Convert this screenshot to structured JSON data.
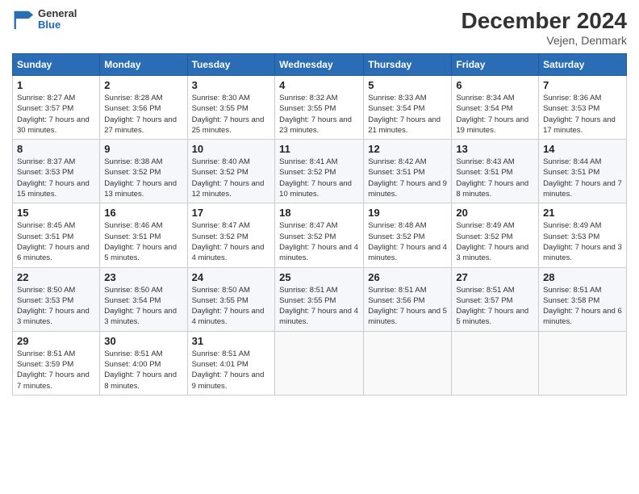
{
  "logo": {
    "general": "General",
    "blue": "Blue"
  },
  "title": "December 2024",
  "location": "Vejen, Denmark",
  "headers": [
    "Sunday",
    "Monday",
    "Tuesday",
    "Wednesday",
    "Thursday",
    "Friday",
    "Saturday"
  ],
  "weeks": [
    [
      {
        "day": "1",
        "sunrise": "Sunrise: 8:27 AM",
        "sunset": "Sunset: 3:57 PM",
        "daylight": "Daylight: 7 hours and 30 minutes."
      },
      {
        "day": "2",
        "sunrise": "Sunrise: 8:28 AM",
        "sunset": "Sunset: 3:56 PM",
        "daylight": "Daylight: 7 hours and 27 minutes."
      },
      {
        "day": "3",
        "sunrise": "Sunrise: 8:30 AM",
        "sunset": "Sunset: 3:55 PM",
        "daylight": "Daylight: 7 hours and 25 minutes."
      },
      {
        "day": "4",
        "sunrise": "Sunrise: 8:32 AM",
        "sunset": "Sunset: 3:55 PM",
        "daylight": "Daylight: 7 hours and 23 minutes."
      },
      {
        "day": "5",
        "sunrise": "Sunrise: 8:33 AM",
        "sunset": "Sunset: 3:54 PM",
        "daylight": "Daylight: 7 hours and 21 minutes."
      },
      {
        "day": "6",
        "sunrise": "Sunrise: 8:34 AM",
        "sunset": "Sunset: 3:54 PM",
        "daylight": "Daylight: 7 hours and 19 minutes."
      },
      {
        "day": "7",
        "sunrise": "Sunrise: 8:36 AM",
        "sunset": "Sunset: 3:53 PM",
        "daylight": "Daylight: 7 hours and 17 minutes."
      }
    ],
    [
      {
        "day": "8",
        "sunrise": "Sunrise: 8:37 AM",
        "sunset": "Sunset: 3:53 PM",
        "daylight": "Daylight: 7 hours and 15 minutes."
      },
      {
        "day": "9",
        "sunrise": "Sunrise: 8:38 AM",
        "sunset": "Sunset: 3:52 PM",
        "daylight": "Daylight: 7 hours and 13 minutes."
      },
      {
        "day": "10",
        "sunrise": "Sunrise: 8:40 AM",
        "sunset": "Sunset: 3:52 PM",
        "daylight": "Daylight: 7 hours and 12 minutes."
      },
      {
        "day": "11",
        "sunrise": "Sunrise: 8:41 AM",
        "sunset": "Sunset: 3:52 PM",
        "daylight": "Daylight: 7 hours and 10 minutes."
      },
      {
        "day": "12",
        "sunrise": "Sunrise: 8:42 AM",
        "sunset": "Sunset: 3:51 PM",
        "daylight": "Daylight: 7 hours and 9 minutes."
      },
      {
        "day": "13",
        "sunrise": "Sunrise: 8:43 AM",
        "sunset": "Sunset: 3:51 PM",
        "daylight": "Daylight: 7 hours and 8 minutes."
      },
      {
        "day": "14",
        "sunrise": "Sunrise: 8:44 AM",
        "sunset": "Sunset: 3:51 PM",
        "daylight": "Daylight: 7 hours and 7 minutes."
      }
    ],
    [
      {
        "day": "15",
        "sunrise": "Sunrise: 8:45 AM",
        "sunset": "Sunset: 3:51 PM",
        "daylight": "Daylight: 7 hours and 6 minutes."
      },
      {
        "day": "16",
        "sunrise": "Sunrise: 8:46 AM",
        "sunset": "Sunset: 3:51 PM",
        "daylight": "Daylight: 7 hours and 5 minutes."
      },
      {
        "day": "17",
        "sunrise": "Sunrise: 8:47 AM",
        "sunset": "Sunset: 3:52 PM",
        "daylight": "Daylight: 7 hours and 4 minutes."
      },
      {
        "day": "18",
        "sunrise": "Sunrise: 8:47 AM",
        "sunset": "Sunset: 3:52 PM",
        "daylight": "Daylight: 7 hours and 4 minutes."
      },
      {
        "day": "19",
        "sunrise": "Sunrise: 8:48 AM",
        "sunset": "Sunset: 3:52 PM",
        "daylight": "Daylight: 7 hours and 4 minutes."
      },
      {
        "day": "20",
        "sunrise": "Sunrise: 8:49 AM",
        "sunset": "Sunset: 3:52 PM",
        "daylight": "Daylight: 7 hours and 3 minutes."
      },
      {
        "day": "21",
        "sunrise": "Sunrise: 8:49 AM",
        "sunset": "Sunset: 3:53 PM",
        "daylight": "Daylight: 7 hours and 3 minutes."
      }
    ],
    [
      {
        "day": "22",
        "sunrise": "Sunrise: 8:50 AM",
        "sunset": "Sunset: 3:53 PM",
        "daylight": "Daylight: 7 hours and 3 minutes."
      },
      {
        "day": "23",
        "sunrise": "Sunrise: 8:50 AM",
        "sunset": "Sunset: 3:54 PM",
        "daylight": "Daylight: 7 hours and 3 minutes."
      },
      {
        "day": "24",
        "sunrise": "Sunrise: 8:50 AM",
        "sunset": "Sunset: 3:55 PM",
        "daylight": "Daylight: 7 hours and 4 minutes."
      },
      {
        "day": "25",
        "sunrise": "Sunrise: 8:51 AM",
        "sunset": "Sunset: 3:55 PM",
        "daylight": "Daylight: 7 hours and 4 minutes."
      },
      {
        "day": "26",
        "sunrise": "Sunrise: 8:51 AM",
        "sunset": "Sunset: 3:56 PM",
        "daylight": "Daylight: 7 hours and 5 minutes."
      },
      {
        "day": "27",
        "sunrise": "Sunrise: 8:51 AM",
        "sunset": "Sunset: 3:57 PM",
        "daylight": "Daylight: 7 hours and 5 minutes."
      },
      {
        "day": "28",
        "sunrise": "Sunrise: 8:51 AM",
        "sunset": "Sunset: 3:58 PM",
        "daylight": "Daylight: 7 hours and 6 minutes."
      }
    ],
    [
      {
        "day": "29",
        "sunrise": "Sunrise: 8:51 AM",
        "sunset": "Sunset: 3:59 PM",
        "daylight": "Daylight: 7 hours and 7 minutes."
      },
      {
        "day": "30",
        "sunrise": "Sunrise: 8:51 AM",
        "sunset": "Sunset: 4:00 PM",
        "daylight": "Daylight: 7 hours and 8 minutes."
      },
      {
        "day": "31",
        "sunrise": "Sunrise: 8:51 AM",
        "sunset": "Sunset: 4:01 PM",
        "daylight": "Daylight: 7 hours and 9 minutes."
      },
      null,
      null,
      null,
      null
    ]
  ]
}
